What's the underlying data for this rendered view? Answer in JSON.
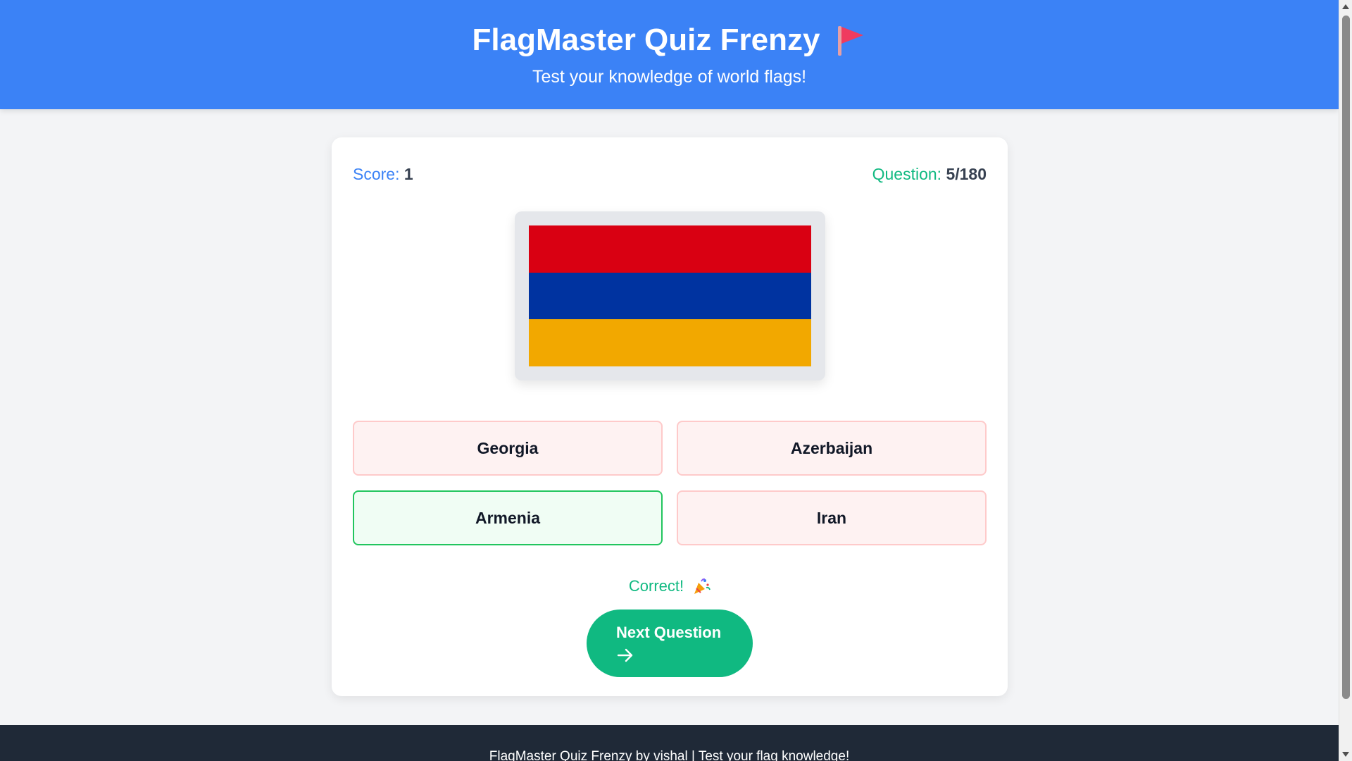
{
  "header": {
    "title": "FlagMaster Quiz Frenzy",
    "subtitle": "Test your knowledge of world flags!",
    "title_icon": "red-flag-icon"
  },
  "stats": {
    "score_label": "Score:",
    "score_value": "1",
    "question_label": "Question:",
    "question_value": "5/180"
  },
  "flag": {
    "country_stripes": [
      "#d90012",
      "#0033a0",
      "#f2a800"
    ]
  },
  "options": [
    {
      "label": "Georgia",
      "state": "incorrect"
    },
    {
      "label": "Azerbaijan",
      "state": "incorrect"
    },
    {
      "label": "Armenia",
      "state": "correct"
    },
    {
      "label": "Iran",
      "state": "incorrect"
    }
  ],
  "feedback": {
    "text": "Correct!",
    "icon": "party-popper-icon"
  },
  "next_button": {
    "label": "Next Question",
    "icon": "arrow-right-icon"
  },
  "footer": {
    "text": "FlagMaster Quiz Frenzy by vishal | Test your flag knowledge!"
  },
  "colors": {
    "header_bg": "#3b82f6",
    "accent_green": "#10b981",
    "footer_bg": "#1f2937"
  }
}
